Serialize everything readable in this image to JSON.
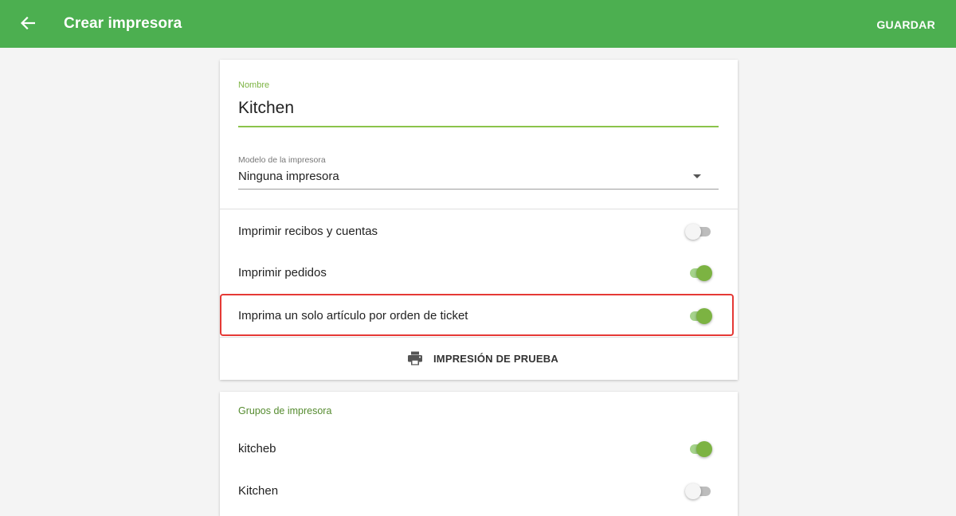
{
  "appbar": {
    "title": "Crear impresora",
    "save_label": "GUARDAR",
    "back_icon": "arrow-left-icon",
    "background_color": "#4caf50"
  },
  "printer": {
    "name_label": "Nombre",
    "name_value": "Kitchen",
    "model_label": "Modelo de la impresora",
    "model_value": "Ninguna impresora",
    "settings": [
      {
        "label": "Imprimir recibos y cuentas",
        "enabled": false
      },
      {
        "label": "Imprimir pedidos",
        "enabled": true
      },
      {
        "label": "Imprima un solo artículo por orden de ticket",
        "enabled": true,
        "highlighted": true
      }
    ],
    "test_print_label": "IMPRESIÓN DE PRUEBA",
    "test_print_icon": "printer-icon"
  },
  "groups": {
    "title": "Grupos de impresora",
    "items": [
      {
        "label": "kitcheb",
        "enabled": true
      },
      {
        "label": "Kitchen",
        "enabled": false
      }
    ]
  },
  "colors": {
    "accent": "#7cb342",
    "highlight_border": "#e53935"
  }
}
